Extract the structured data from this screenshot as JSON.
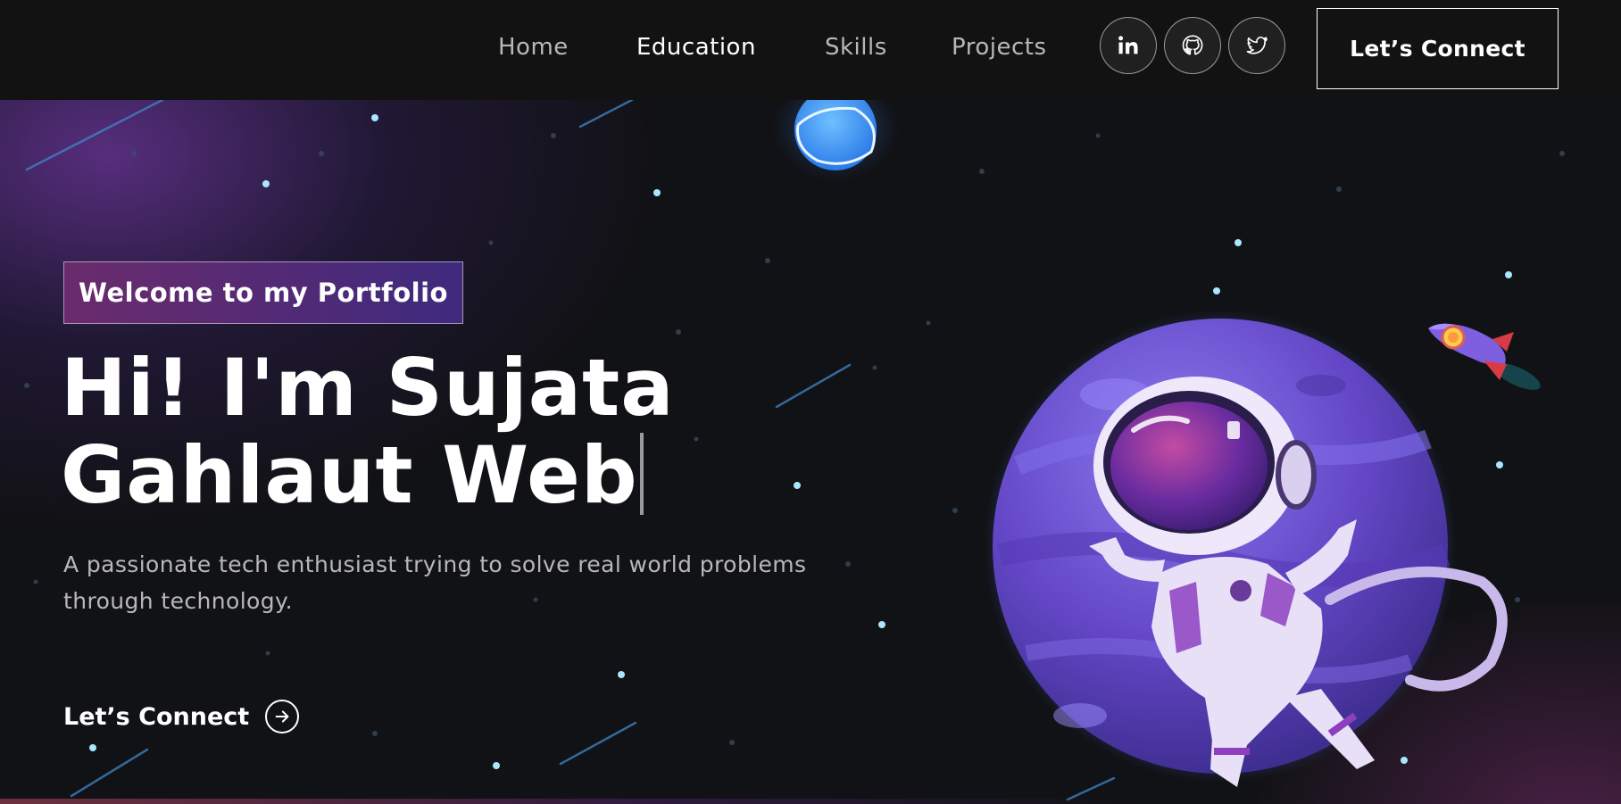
{
  "nav": {
    "links": [
      "Home",
      "Education",
      "Skills",
      "Projects"
    ],
    "active": "Education",
    "social_icons": [
      "linkedin-icon",
      "github-icon",
      "twitter-icon"
    ],
    "connect_label": "Let’s Connect"
  },
  "hero": {
    "tagline": "Welcome to my Portfolio",
    "headline_line1": "Hi! I'm Sujata",
    "headline_line2": "Gahlaut Web",
    "description": "A passionate tech enthusiast trying to solve real world problems through technology.",
    "connect_label": "Let’s Connect",
    "connect_icon": "arrow-right-circle-icon"
  },
  "colors": {
    "background": "#121212",
    "tagline_gradient_start": "#6a2b6c",
    "tagline_gradient_end": "#3f2a7e",
    "planet": "#6a4fd0",
    "text_muted": "#b8b8b8"
  }
}
